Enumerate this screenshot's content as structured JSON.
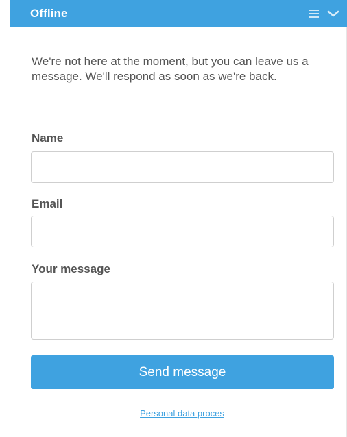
{
  "header": {
    "title": "Offline",
    "icons": [
      "menu-icon",
      "chevron-down-icon"
    ]
  },
  "intro_text": "We're not here at the moment, but you can leave us a message. We'll respond as soon as we're back.",
  "form": {
    "name_label": "Name",
    "name_value": "",
    "email_label": "Email",
    "email_value": "",
    "message_label": "Your message",
    "message_value": "",
    "send_label": "Send message"
  },
  "footer": {
    "link_text": "Personal data proces"
  },
  "colors": {
    "accent": "#3fa2e0",
    "text": "#555555",
    "border": "#cfcfcf"
  }
}
